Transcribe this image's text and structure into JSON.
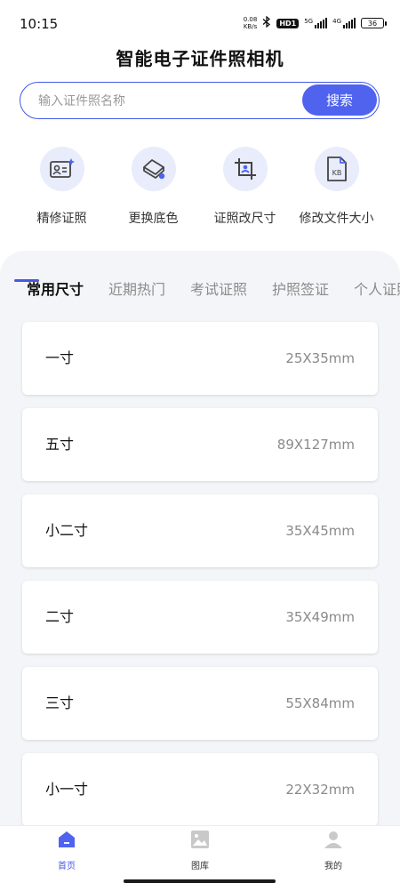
{
  "status_bar": {
    "time": "10:15",
    "net_speed_value": "0.08",
    "net_speed_unit": "KB/s",
    "hd_badge": "HD1",
    "signal1_label": "5G",
    "signal2_label": "4G",
    "battery": "36"
  },
  "app": {
    "title": "智能电子证件照相机"
  },
  "search": {
    "placeholder": "输入证件照名称",
    "button_label": "搜索"
  },
  "tools": [
    {
      "label": "精修证照",
      "icon": "portrait-retouch-icon"
    },
    {
      "label": "更换底色",
      "icon": "background-color-icon"
    },
    {
      "label": "证照改尺寸",
      "icon": "crop-resize-icon"
    },
    {
      "label": "修改文件大小",
      "icon": "file-size-icon",
      "icon_text": "KB"
    }
  ],
  "tabs": [
    {
      "label": "常用尺寸",
      "active": true
    },
    {
      "label": "近期热门"
    },
    {
      "label": "考试证照"
    },
    {
      "label": "护照签证"
    },
    {
      "label": "个人证照"
    }
  ],
  "sizes": [
    {
      "name": "一寸",
      "dims": "25X35mm"
    },
    {
      "name": "五寸",
      "dims": "89X127mm"
    },
    {
      "name": "小二寸",
      "dims": "35X45mm"
    },
    {
      "name": "二寸",
      "dims": "35X49mm"
    },
    {
      "name": "三寸",
      "dims": "55X84mm"
    },
    {
      "name": "小一寸",
      "dims": "22X32mm"
    }
  ],
  "bottom_nav": [
    {
      "label": "首页",
      "active": true
    },
    {
      "label": "图库"
    },
    {
      "label": "我的"
    }
  ],
  "colors": {
    "accent": "#4f63ef",
    "accent_dark": "#4459e5",
    "icon_bg": "#e8ecfb",
    "panel_bg": "#f4f5f8"
  }
}
